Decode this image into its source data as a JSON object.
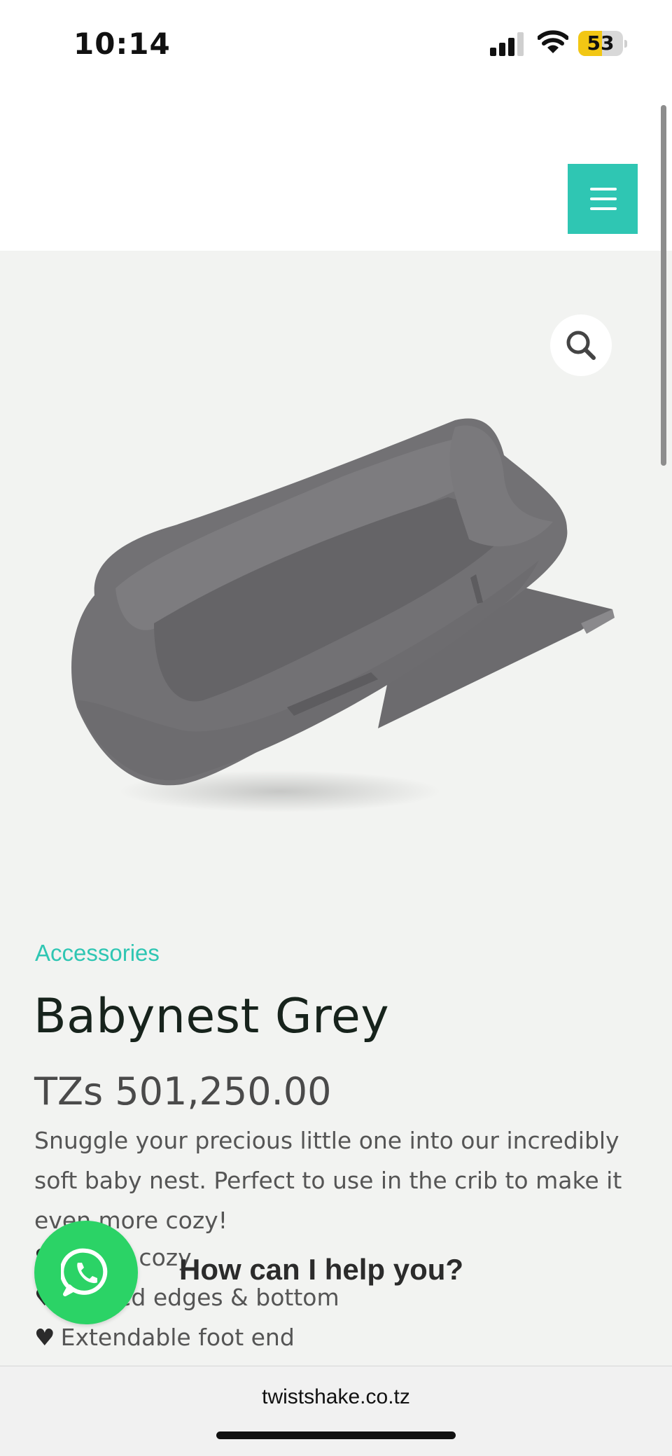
{
  "status_bar": {
    "time": "10:14",
    "battery_percent": 53
  },
  "header": {
    "menu_icon": "hamburger-icon"
  },
  "product": {
    "search_icon": "search-icon",
    "category": "Accessories",
    "title": "Babynest Grey",
    "price": "TZs 501,250.00",
    "description": "Snuggle your precious little one into our incredibly soft baby nest. Perfect to use in the crib to make it even more cozy!",
    "features": [
      "Soft & cozy",
      "Padded edges & bottom",
      "Extendable foot end"
    ],
    "feature_icon": "heart-icon"
  },
  "whatsapp": {
    "prompt": "How can I help you?",
    "icon": "whatsapp-icon"
  },
  "browser": {
    "url": "twistshake.co.tz"
  },
  "colors": {
    "accent": "#2fc6b3",
    "whatsapp": "#2bd366",
    "page_bg": "#f2f3f1"
  }
}
